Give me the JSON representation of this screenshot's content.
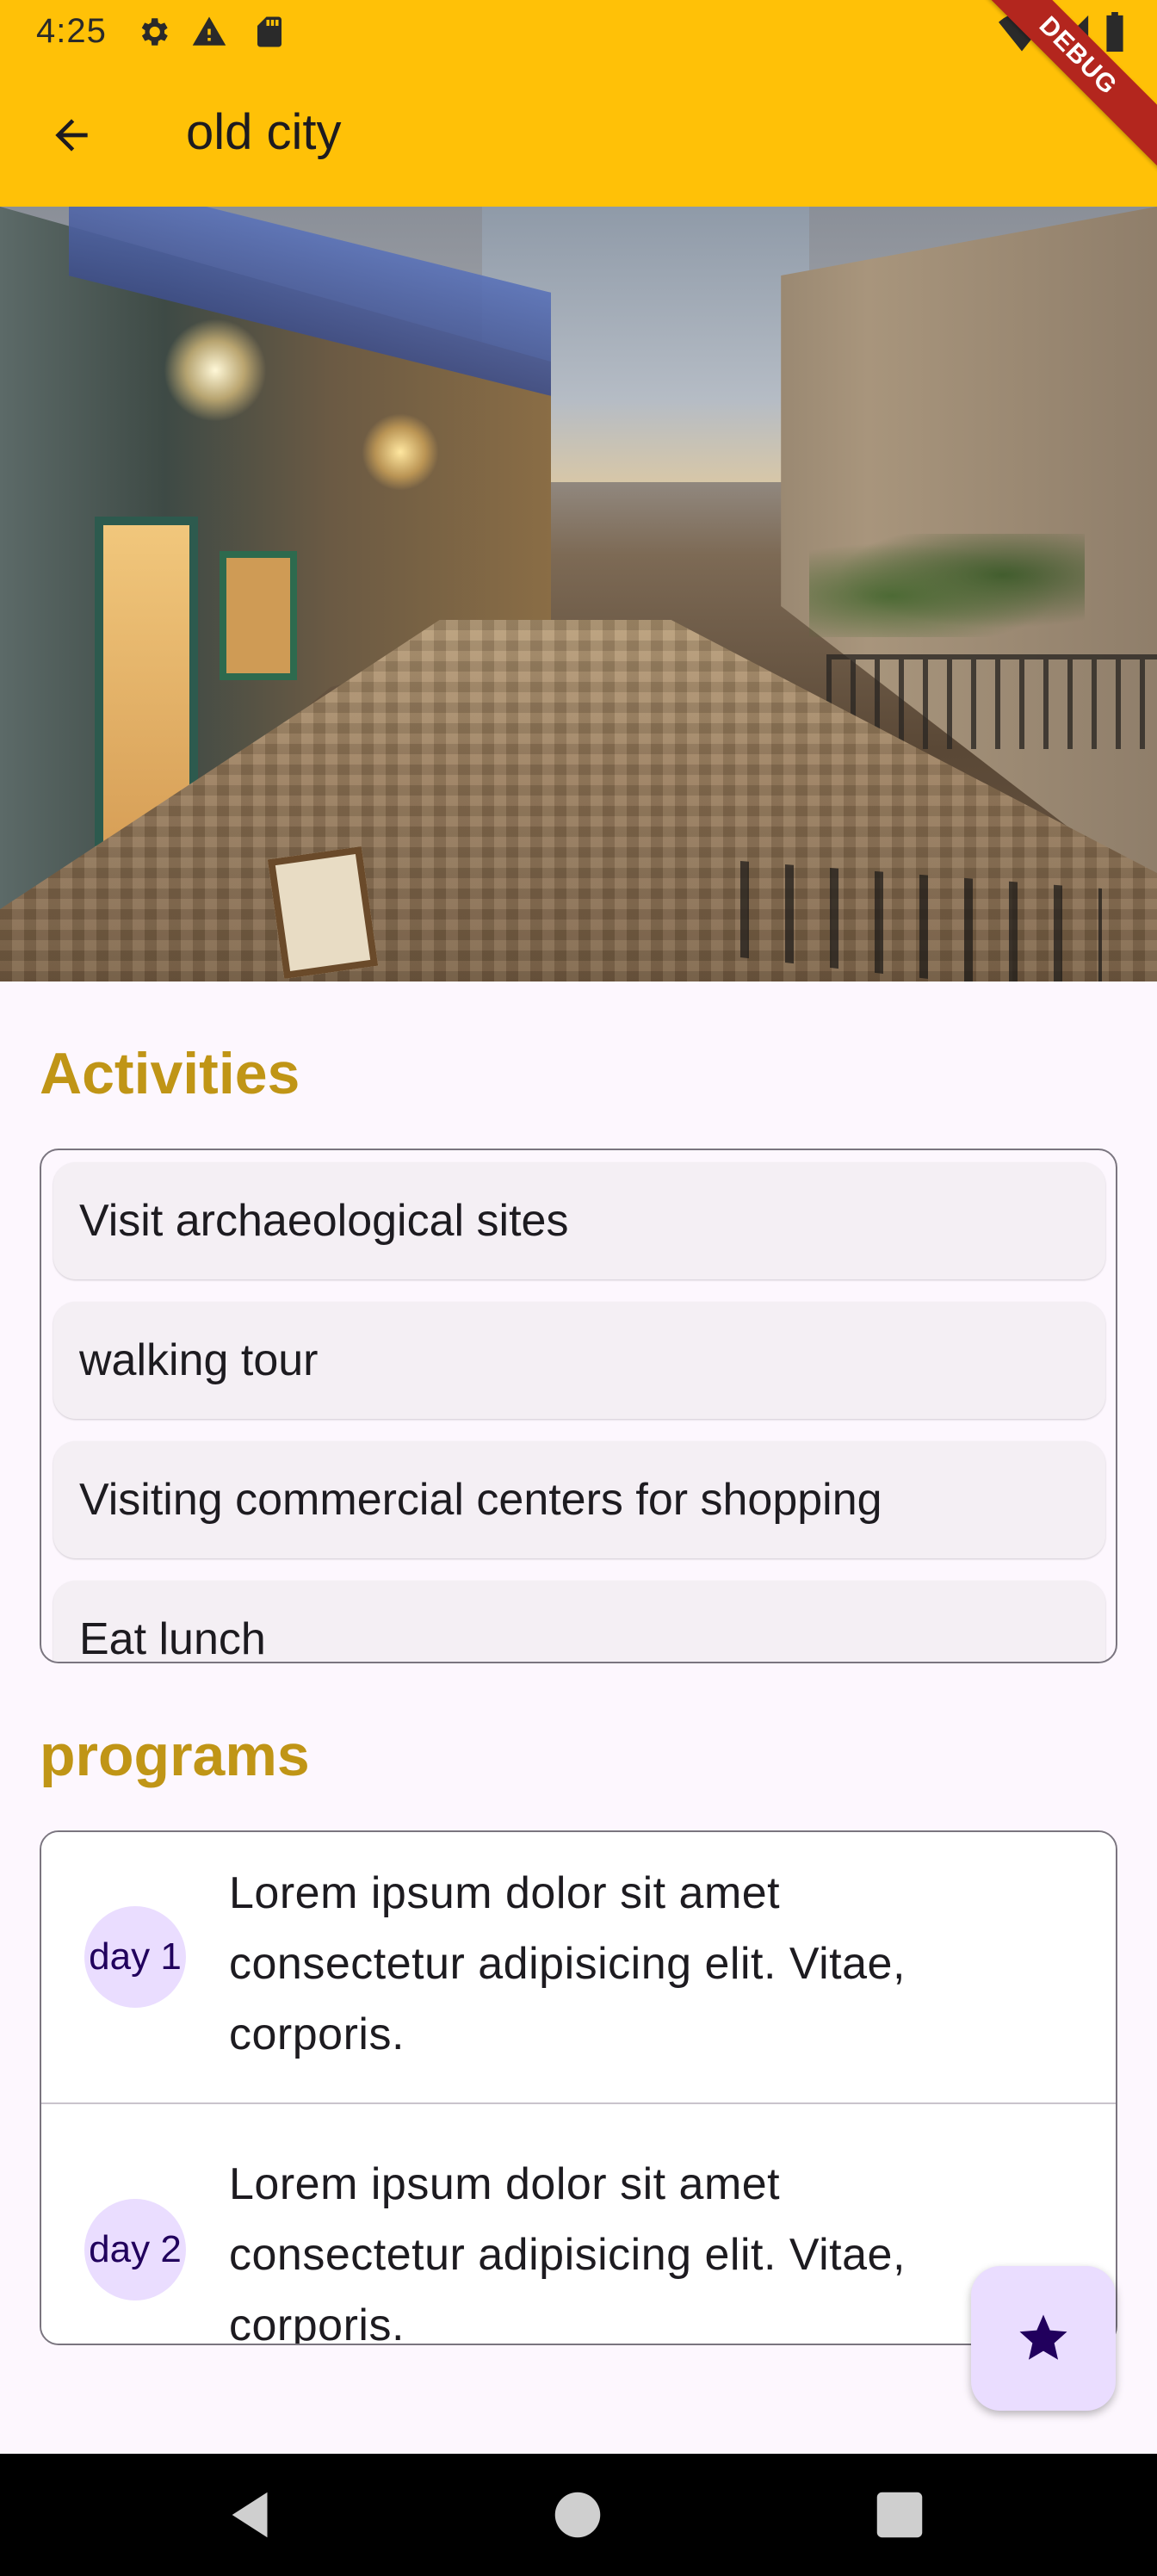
{
  "status_bar": {
    "time": "4:25",
    "icons": [
      "gear-icon",
      "warning-icon",
      "sd-card-icon",
      "wifi-icon",
      "signal-icon",
      "battery-icon"
    ]
  },
  "debug_banner": "DEBUG",
  "app_bar": {
    "title": "old city",
    "back_icon": "arrow-back-icon",
    "background_color": "#ffc107"
  },
  "hero_image": {
    "description_icon": "old-city-street-photo"
  },
  "activities": {
    "heading": "Activities",
    "items": [
      "Visit archaeological sites",
      "walking tour",
      "Visiting commercial centers for shopping",
      "Eat lunch"
    ]
  },
  "programs": {
    "heading": "programs",
    "items": [
      {
        "day": "day 1",
        "lines": [
          "Lorem ipsum dolor sit amet",
          "consectetur adipisicing elit. Vitae,",
          "corporis."
        ]
      },
      {
        "day": "day 2",
        "lines": [
          "Lorem ipsum dolor sit amet",
          "consectetur adipisicing elit. Vitae,",
          "corporis."
        ]
      }
    ]
  },
  "fab": {
    "icon": "star-icon"
  },
  "colors": {
    "accent_heading": "#c09516",
    "avatar_bg": "#eaddff",
    "page_bg": "#fdf7fe"
  },
  "nav_bar": {
    "icons": [
      "nav-back-icon",
      "nav-home-icon",
      "nav-recents-icon"
    ]
  }
}
